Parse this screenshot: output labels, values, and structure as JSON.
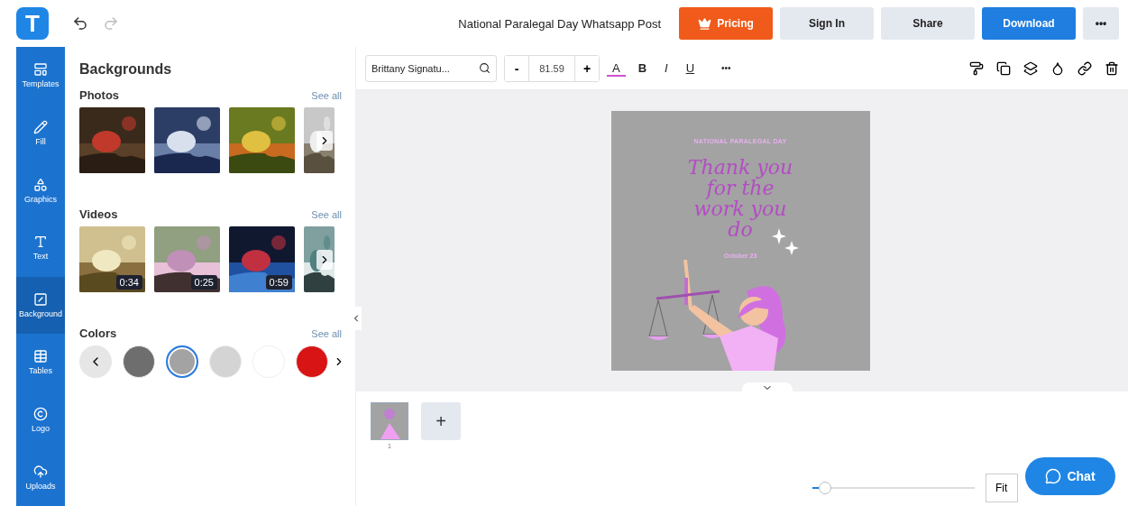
{
  "header": {
    "logo": "T",
    "title": "National Paralegal Day Whatsapp Post",
    "buttons": [
      {
        "kind": "pricing",
        "label": "Pricing"
      },
      {
        "kind": "plain",
        "label": "Sign In"
      },
      {
        "kind": "plain",
        "label": "Share"
      },
      {
        "kind": "primary",
        "label": "Download"
      },
      {
        "kind": "more",
        "label": "•••"
      }
    ]
  },
  "sidebar": {
    "items": [
      {
        "kind": "templates",
        "label": "Templates",
        "selected": false
      },
      {
        "kind": "fill",
        "label": "Fill",
        "selected": false
      },
      {
        "kind": "graphics",
        "label": "Graphics",
        "selected": false
      },
      {
        "kind": "text",
        "label": "Text",
        "selected": false
      },
      {
        "kind": "background",
        "label": "Background",
        "selected": true
      },
      {
        "kind": "tables",
        "label": "Tables",
        "selected": false
      },
      {
        "kind": "logo",
        "label": "Logo",
        "selected": false
      },
      {
        "kind": "uploads",
        "label": "Uploads",
        "selected": false
      }
    ]
  },
  "panel": {
    "title": "Backgrounds",
    "photos": {
      "title": "Photos",
      "see_all": "See all",
      "items": [
        {
          "kind": "picture"
        },
        {
          "kind": "picture"
        },
        {
          "kind": "picture"
        },
        {
          "kind": "picture"
        }
      ]
    },
    "videos": {
      "title": "Videos",
      "see_all": "See all",
      "items": [
        {
          "kind": "picture",
          "duration": "0:34"
        },
        {
          "kind": "picture",
          "duration": "0:25"
        },
        {
          "kind": "picture",
          "duration": "0:59"
        },
        {
          "kind": "picture"
        }
      ]
    },
    "colors": {
      "title": "Colors",
      "see_all": "See all",
      "swatches": [
        {
          "color": "#6e6e6e",
          "selected": false
        },
        {
          "color": "#a3a3a3",
          "selected": true
        },
        {
          "color": "#d4d4d4",
          "selected": false
        },
        {
          "color": "#ffffff",
          "selected": false
        },
        {
          "color": "#d81414",
          "selected": false
        }
      ]
    }
  },
  "toolbar": {
    "font": "Brittany Signatu...",
    "font_size": "81.59",
    "minus": "-",
    "plus": "+",
    "text_color": "A",
    "bold": "B",
    "italic": "I",
    "underline": "U",
    "more": "•••"
  },
  "design": {
    "heading": "NATIONAL PARALEGAL DAY",
    "script": "Thank you for the work you do",
    "date": "October 23"
  },
  "pages": [
    {
      "number": "1",
      "selected": true
    }
  ],
  "add_page": "+",
  "zoom": {
    "level": 0.08,
    "fit": "Fit"
  },
  "chat": {
    "label": "Chat"
  }
}
